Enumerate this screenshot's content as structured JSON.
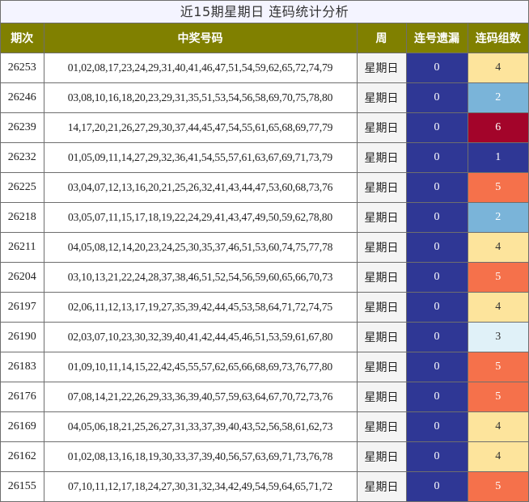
{
  "title": "近15期星期日 连码统计分析",
  "headers": {
    "issue": "期次",
    "numbers": "中奖号码",
    "week": "周",
    "omission": "连号遗漏",
    "groups": "连码组数"
  },
  "colors": {
    "header_bg": "#808000",
    "omission_bg": "#2f3795",
    "group_colors": {
      "1": "#2f3795",
      "2": "#7ab4d9",
      "3": "#e0f1f8",
      "4": "#fde49c",
      "5": "#f5714b",
      "6": "#a3042a"
    }
  },
  "rows": [
    {
      "issue": "26253",
      "numbers": "01,02,08,17,23,24,29,31,40,41,46,47,51,54,59,62,65,72,74,79",
      "week": "星期日",
      "omission": "0",
      "groups": "4"
    },
    {
      "issue": "26246",
      "numbers": "03,08,10,16,18,20,23,29,31,35,51,53,54,56,58,69,70,75,78,80",
      "week": "星期日",
      "omission": "0",
      "groups": "2"
    },
    {
      "issue": "26239",
      "numbers": "14,17,20,21,26,27,29,30,37,44,45,47,54,55,61,65,68,69,77,79",
      "week": "星期日",
      "omission": "0",
      "groups": "6"
    },
    {
      "issue": "26232",
      "numbers": "01,05,09,11,14,27,29,32,36,41,54,55,57,61,63,67,69,71,73,79",
      "week": "星期日",
      "omission": "0",
      "groups": "1"
    },
    {
      "issue": "26225",
      "numbers": "03,04,07,12,13,16,20,21,25,26,32,41,43,44,47,53,60,68,73,76",
      "week": "星期日",
      "omission": "0",
      "groups": "5"
    },
    {
      "issue": "26218",
      "numbers": "03,05,07,11,15,17,18,19,22,24,29,41,43,47,49,50,59,62,78,80",
      "week": "星期日",
      "omission": "0",
      "groups": "2"
    },
    {
      "issue": "26211",
      "numbers": "04,05,08,12,14,20,23,24,25,30,35,37,46,51,53,60,74,75,77,78",
      "week": "星期日",
      "omission": "0",
      "groups": "4"
    },
    {
      "issue": "26204",
      "numbers": "03,10,13,21,22,24,28,37,38,46,51,52,54,56,59,60,65,66,70,73",
      "week": "星期日",
      "omission": "0",
      "groups": "5"
    },
    {
      "issue": "26197",
      "numbers": "02,06,11,12,13,17,19,27,35,39,42,44,45,53,58,64,71,72,74,75",
      "week": "星期日",
      "omission": "0",
      "groups": "4"
    },
    {
      "issue": "26190",
      "numbers": "02,03,07,10,23,30,32,39,40,41,42,44,45,46,51,53,59,61,67,80",
      "week": "星期日",
      "omission": "0",
      "groups": "3"
    },
    {
      "issue": "26183",
      "numbers": "01,09,10,11,14,15,22,42,45,55,57,62,65,66,68,69,73,76,77,80",
      "week": "星期日",
      "omission": "0",
      "groups": "5"
    },
    {
      "issue": "26176",
      "numbers": "07,08,14,21,22,26,29,33,36,39,40,57,59,63,64,67,70,72,73,76",
      "week": "星期日",
      "omission": "0",
      "groups": "5"
    },
    {
      "issue": "26169",
      "numbers": "04,05,06,18,21,25,26,27,31,33,37,39,40,43,52,56,58,61,62,73",
      "week": "星期日",
      "omission": "0",
      "groups": "4"
    },
    {
      "issue": "26162",
      "numbers": "01,02,08,13,16,18,19,30,33,37,39,40,56,57,63,69,71,73,76,78",
      "week": "星期日",
      "omission": "0",
      "groups": "4"
    },
    {
      "issue": "26155",
      "numbers": "07,10,11,12,17,18,24,27,30,31,32,34,42,49,54,59,64,65,71,72",
      "week": "星期日",
      "omission": "0",
      "groups": "5"
    }
  ]
}
